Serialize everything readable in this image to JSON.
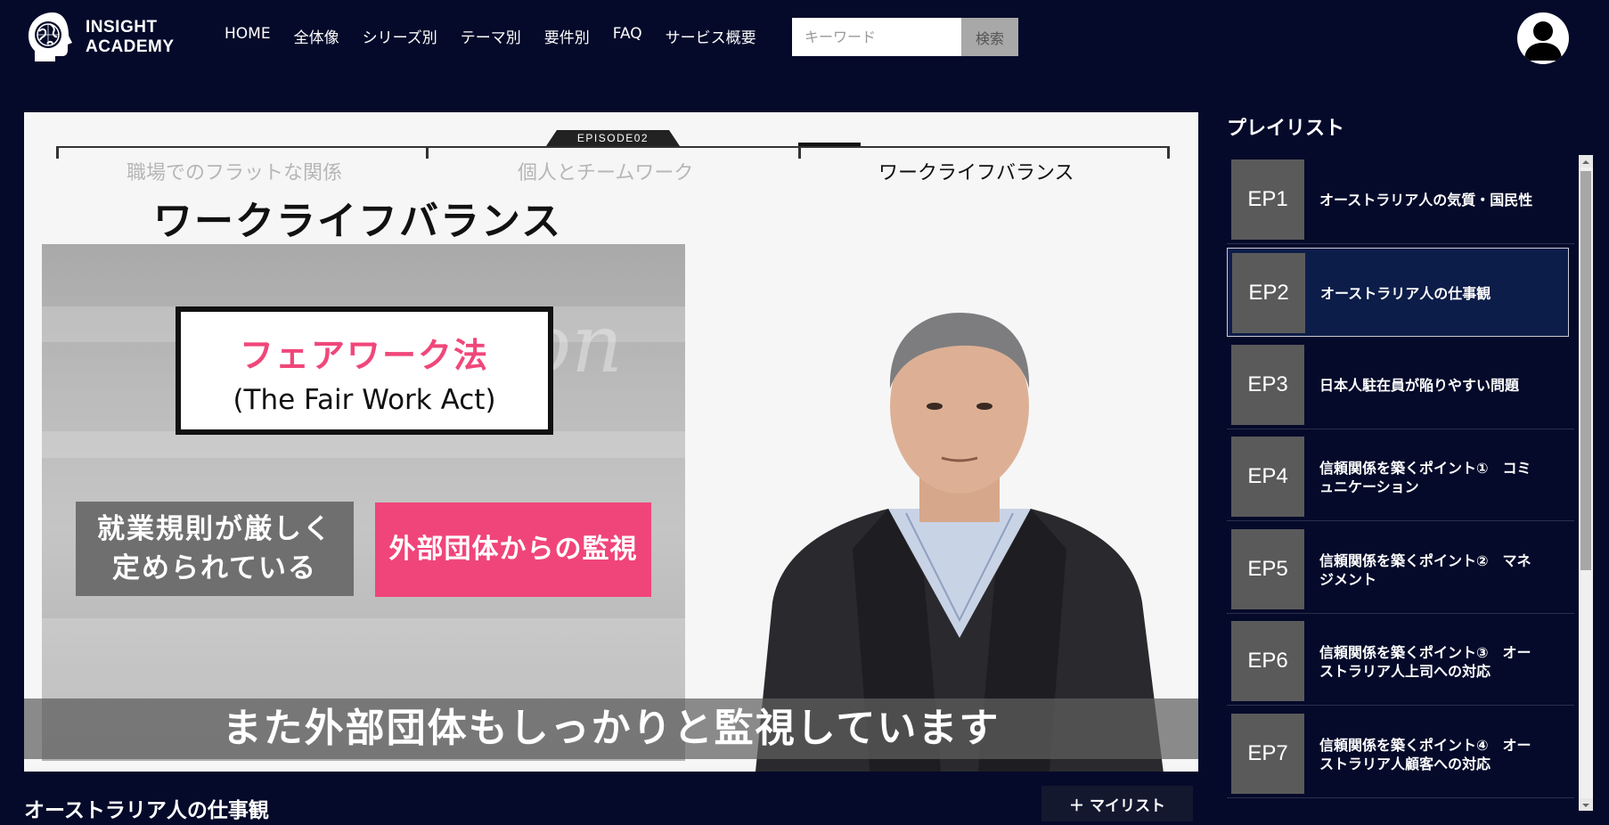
{
  "header": {
    "logo_line1": "INSIGHT",
    "logo_line2": "ACADEMY",
    "nav": [
      "HOME",
      "全体像",
      "シリーズ別",
      "テーマ別",
      "要件別",
      "FAQ",
      "サービス概要"
    ],
    "search": {
      "placeholder": "キーワード",
      "button_label": "検索"
    },
    "avatar_icon": "user-avatar-icon"
  },
  "video": {
    "episode_badge": "EPISODE02",
    "segments": [
      "職場でのフラットな関係",
      "個人とチームワーク",
      "ワークライフバランス"
    ],
    "active_segment": "ワークライフバランス",
    "slide_title": "ワークライフバランス",
    "law_box": {
      "japanese": "フェアワーク法",
      "english": "(The Fair Work Act)"
    },
    "callout_gray_line1": "就業規則が厳しく",
    "callout_gray_line2": "定められている",
    "callout_pink": "外部団体からの監視",
    "subtitle": "また外部団体もしっかりと監視しています"
  },
  "below_video": {
    "title": "オーストラリア人の仕事観",
    "mylist_label": "＋ マイリスト"
  },
  "playlist": {
    "heading": "プレイリスト",
    "items": [
      {
        "ep": "EP1",
        "line1": "オーストラリア人の気質・国民性",
        "line2": ""
      },
      {
        "ep": "EP2",
        "line1": "オーストラリア人の仕事観",
        "line2": ""
      },
      {
        "ep": "EP3",
        "line1": "日本人駐在員が陥りやすい問題",
        "line2": ""
      },
      {
        "ep": "EP4",
        "line1": "信頼関係を築くポイント①　コミ",
        "line2": "ュニケーション"
      },
      {
        "ep": "EP5",
        "line1": "信頼関係を築くポイント②　マネ",
        "line2": "ジメント"
      },
      {
        "ep": "EP6",
        "line1": "信頼関係を築くポイント③　オー",
        "line2": "ストラリア人上司への対応"
      },
      {
        "ep": "EP7",
        "line1": "信頼関係を築くポイント④　オー",
        "line2": "ストラリア人顧客への対応"
      }
    ],
    "selected_index": 1
  },
  "colors": {
    "page_background": "#050a2a",
    "accent_pink": "#f0457a",
    "selected_item": "#0d1d49",
    "thumb_gray": "#5a5a5a"
  }
}
